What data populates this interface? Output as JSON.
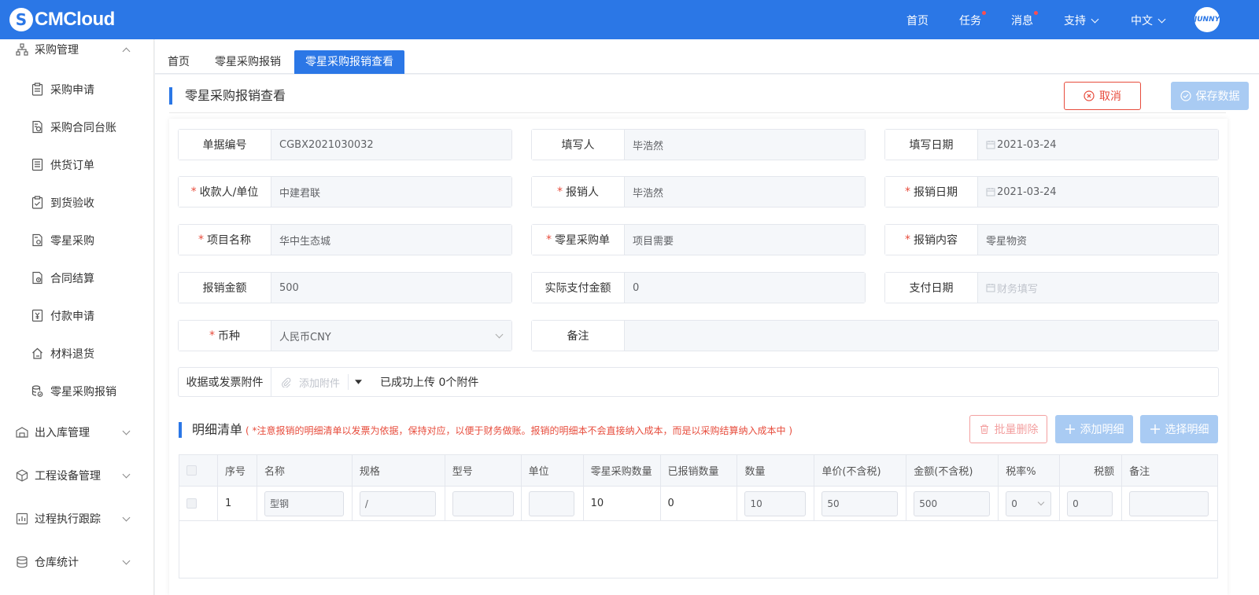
{
  "brand": {
    "name": "CMCloud"
  },
  "topnav": {
    "home": "首页",
    "tasks": "任务",
    "messages": "消息",
    "support": "支持",
    "language": "中文"
  },
  "sidebar": {
    "group_purchase": "采购管理",
    "items": [
      {
        "label": "采购申请"
      },
      {
        "label": "采购合同台账"
      },
      {
        "label": "供货订单"
      },
      {
        "label": "到货验收"
      },
      {
        "label": "零星采购"
      },
      {
        "label": "合同结算"
      },
      {
        "label": "付款申请"
      },
      {
        "label": "材料退货"
      },
      {
        "label": "零星采购报销"
      }
    ],
    "groups": [
      {
        "label": "出入库管理"
      },
      {
        "label": "工程设备管理"
      },
      {
        "label": "过程执行跟踪"
      },
      {
        "label": "仓库统计"
      }
    ]
  },
  "tabs": [
    {
      "label": "首页"
    },
    {
      "label": "零星采购报销"
    },
    {
      "label": "零星采购报销查看"
    }
  ],
  "page": {
    "title": "零星采购报销查看",
    "cancel": "取消",
    "save": "保存数据"
  },
  "form": {
    "doc_no": {
      "label": "单据编号",
      "value": "CGBX2021030032"
    },
    "writer": {
      "label": "填写人",
      "value": "毕浩然"
    },
    "write_date": {
      "label": "填写日期",
      "value": "2021-03-24"
    },
    "payee": {
      "label": "收款人/单位",
      "value": "中建君联"
    },
    "claimant": {
      "label": "报销人",
      "value": "毕浩然"
    },
    "claim_date": {
      "label": "报销日期",
      "value": "2021-03-24"
    },
    "project": {
      "label": "项目名称",
      "value": "华中生态城"
    },
    "order": {
      "label": "零星采购单",
      "value": "项目需要"
    },
    "content": {
      "label": "报销内容",
      "value": "零星物资"
    },
    "amount": {
      "label": "报销金额",
      "value": "500"
    },
    "actual_paid": {
      "label": "实际支付金额",
      "value": "0"
    },
    "pay_date": {
      "label": "支付日期",
      "placeholder": "财务填写"
    },
    "currency": {
      "label": "币种",
      "value": "人民币CNY"
    },
    "remark": {
      "label": "备注",
      "value": ""
    },
    "attachment": {
      "label": "收据或发票附件",
      "add": "添加附件",
      "status": "已成功上传 0个附件"
    }
  },
  "detail": {
    "title": "明细清单",
    "note": "( *注意报销的明细清单以发票为依据，保持对应，以便于财务做账。报销的明细本不会直接纳入成本，而是以采购结算纳入成本中 )",
    "batch_delete": "批量删除",
    "add": "添加明细",
    "select": "选择明细",
    "columns": [
      "序号",
      "名称",
      "规格",
      "型号",
      "单位",
      "零星采购数量",
      "已报销数量",
      "数量",
      "单价(不含税)",
      "金额(不含税)",
      "税率%",
      "税额",
      "备注"
    ],
    "rows": [
      {
        "seq": "1",
        "name": "型钢",
        "spec": "/",
        "model": "",
        "unit": "",
        "order_qty": "10",
        "claimed_qty": "0",
        "qty": "10",
        "price": "50",
        "amount": "500",
        "tax_rate": "0",
        "tax": "0",
        "remark": ""
      }
    ]
  },
  "colors": {
    "primary": "#2b77e6",
    "danger": "#e74c3c",
    "disabled": "#a9cbf3"
  }
}
